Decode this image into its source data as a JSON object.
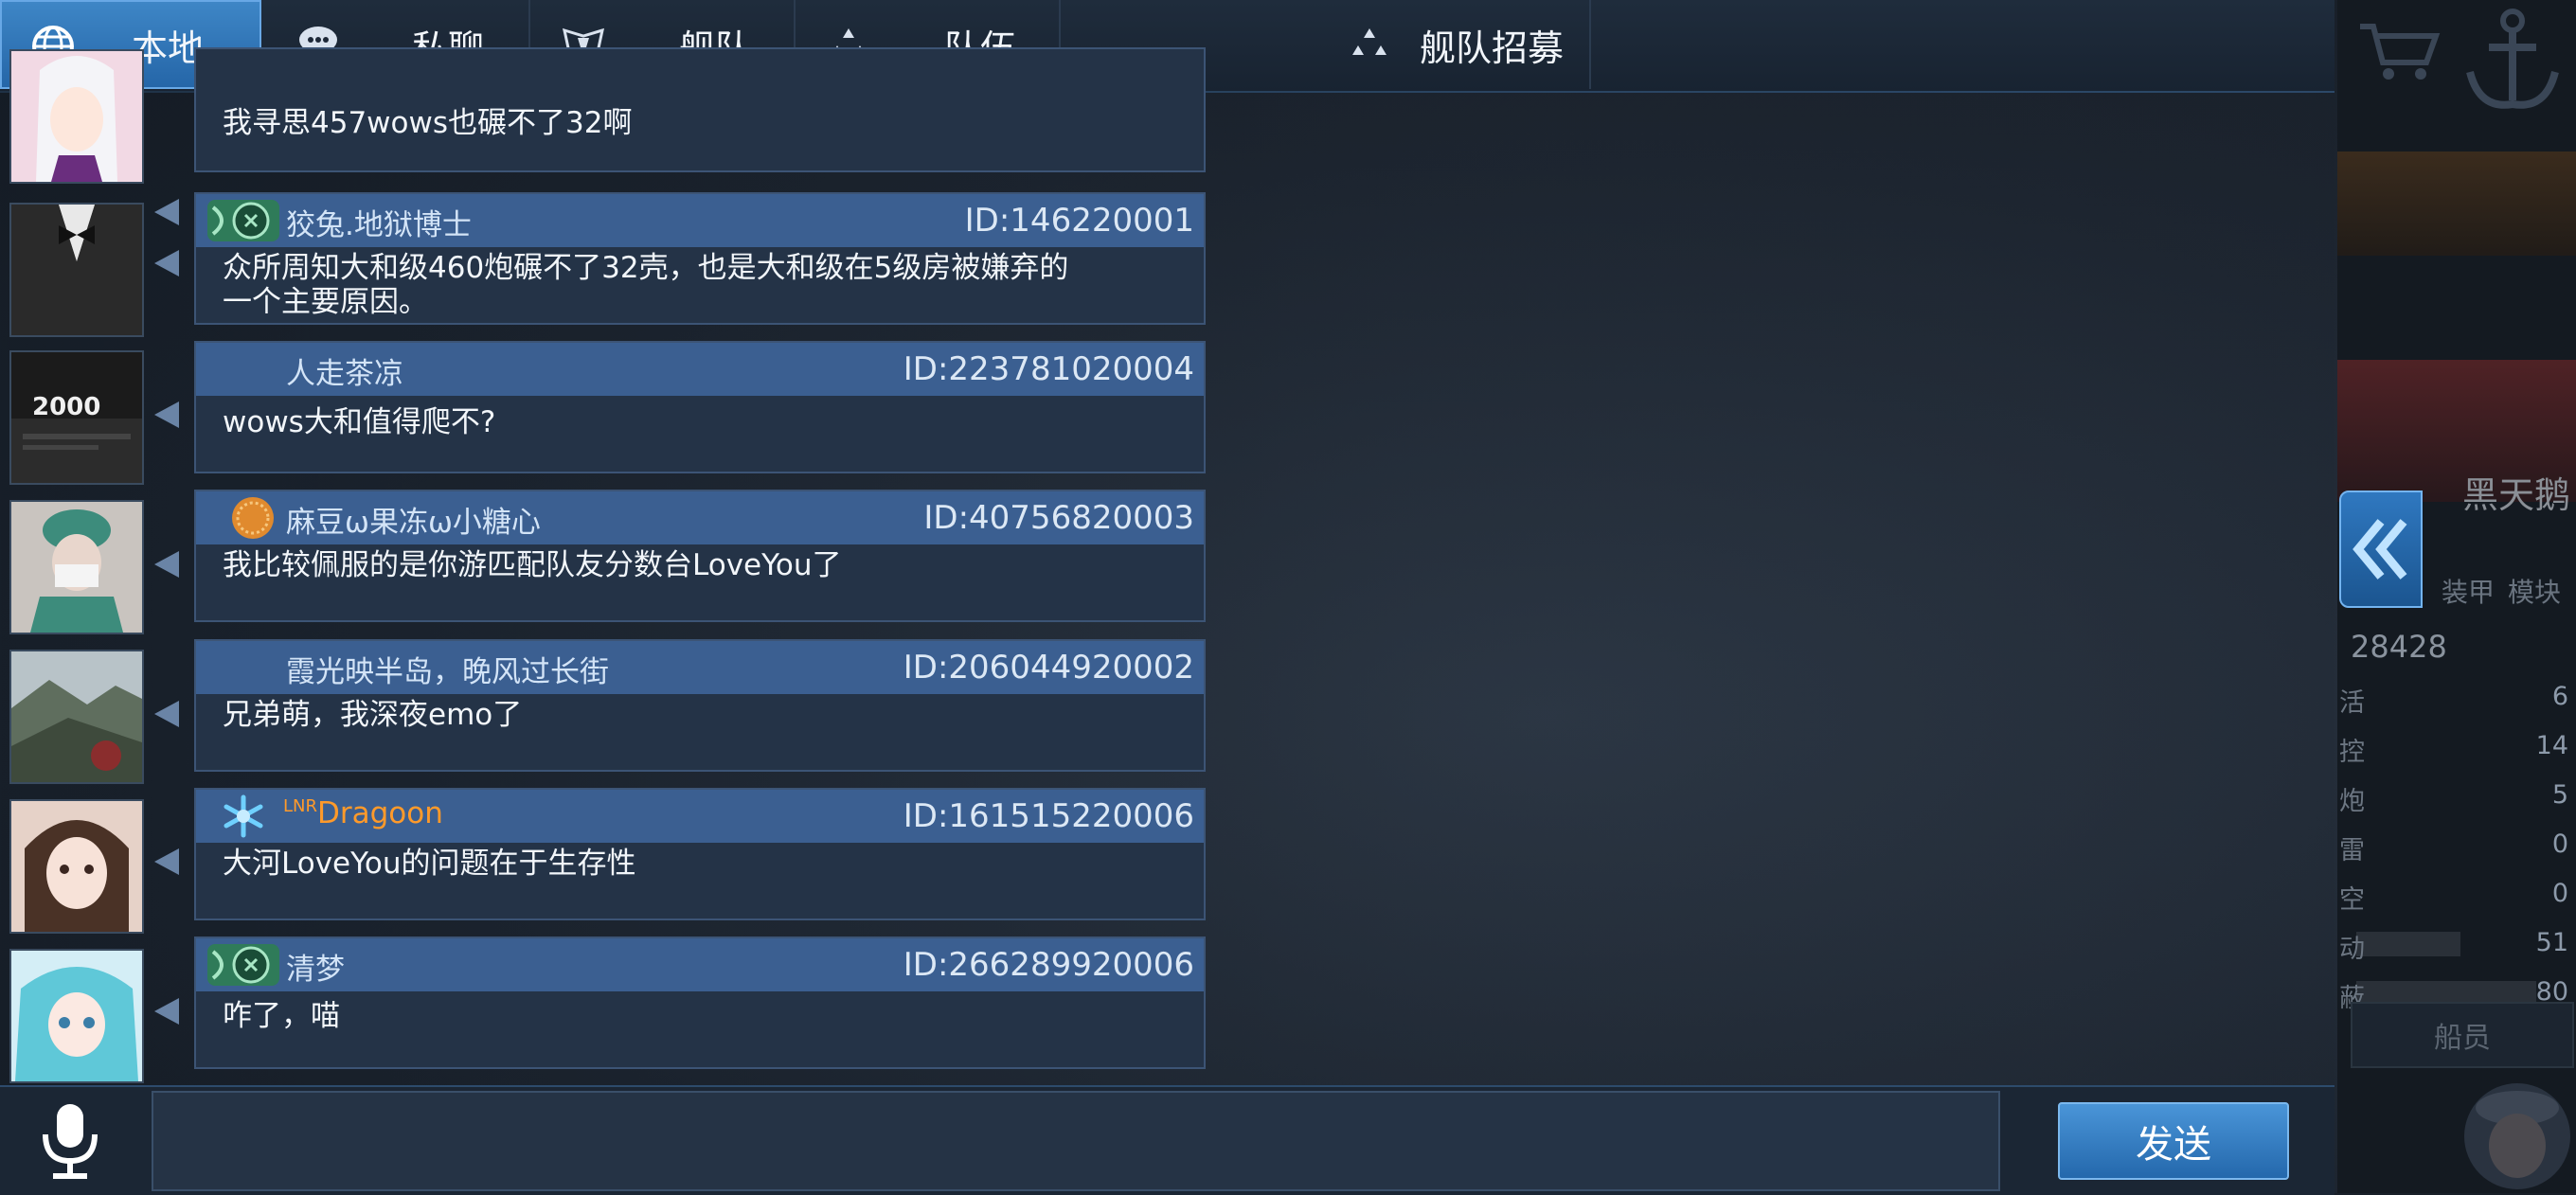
{
  "tabs": [
    {
      "label": "本地",
      "icon": "globe-icon",
      "active": true
    },
    {
      "label": "私聊",
      "icon": "chat-bubble-icon",
      "active": false
    },
    {
      "label": "舰队",
      "icon": "fleet-icon",
      "active": false
    },
    {
      "label": "队伍",
      "icon": "team-icon",
      "active": false
    },
    {
      "label": "舰队招募",
      "icon": "recruit-icon",
      "active": false
    }
  ],
  "messages": [
    {
      "name": "",
      "id": "",
      "text": "我寻思457wows也碾不了32啊",
      "badge": "none",
      "avatar": "anime-girl-white-hair"
    },
    {
      "name": "狡兔.地狱博士",
      "id": "ID:146220001",
      "text": "众所周知大和级460炮碾不了32壳，也是大和级在5级房被嫌弃的\n一个主要原因。",
      "badge": "green-emblem-icon",
      "avatar": "tuxedo"
    },
    {
      "name": "人走茶凉",
      "id": "ID:223781020004",
      "text": "wows大和值得爬不?",
      "badge": "none",
      "avatar": "screen-2000"
    },
    {
      "name": "麻豆ω果冻ω小糖心",
      "id": "ID:40756820003",
      "text": "我比较佩服的是你游匹配队友分数台LoveYou了",
      "badge": "orange-medal-icon",
      "avatar": "nurse-photo"
    },
    {
      "name": "霞光映半岛，晚风过长街",
      "id": "ID:206044920002",
      "text": "兄弟萌，我深夜emo了",
      "badge": "none",
      "avatar": "mountain-photo"
    },
    {
      "name": "Dragoon",
      "name_prefix": "LNR",
      "id": "ID:161515220006",
      "text": "大河LoveYou的问题在于生存性",
      "badge": "snowflake-icon",
      "avatar": "girl-portrait"
    },
    {
      "name": "清梦",
      "id": "ID:266289920006",
      "text": "咋了，喵",
      "badge": "green-emblem-icon",
      "avatar": "miku"
    }
  ],
  "input": {
    "value": "",
    "placeholder": ""
  },
  "send_label": "发送",
  "expand_icon": "double-chevron-left-icon",
  "right_panel": {
    "ship_name": "黑天鹅",
    "tab_armor": "装甲",
    "tab_module": "模块",
    "total": "28428",
    "stats": [
      {
        "label": "活",
        "value": "6"
      },
      {
        "label": "控",
        "value": "14"
      },
      {
        "label": "炮",
        "value": "5"
      },
      {
        "label": "雷",
        "value": "0"
      },
      {
        "label": "空",
        "value": "0"
      },
      {
        "label": "动",
        "value": "51"
      },
      {
        "label": "蔽",
        "value": "80"
      }
    ],
    "crew_label": "船员"
  },
  "colors": {
    "accent": "#2f78c0",
    "header": "#3b5f91",
    "bubble": "#243347",
    "name": "#d3e4f7",
    "dragoon": "#ff9a2a"
  }
}
